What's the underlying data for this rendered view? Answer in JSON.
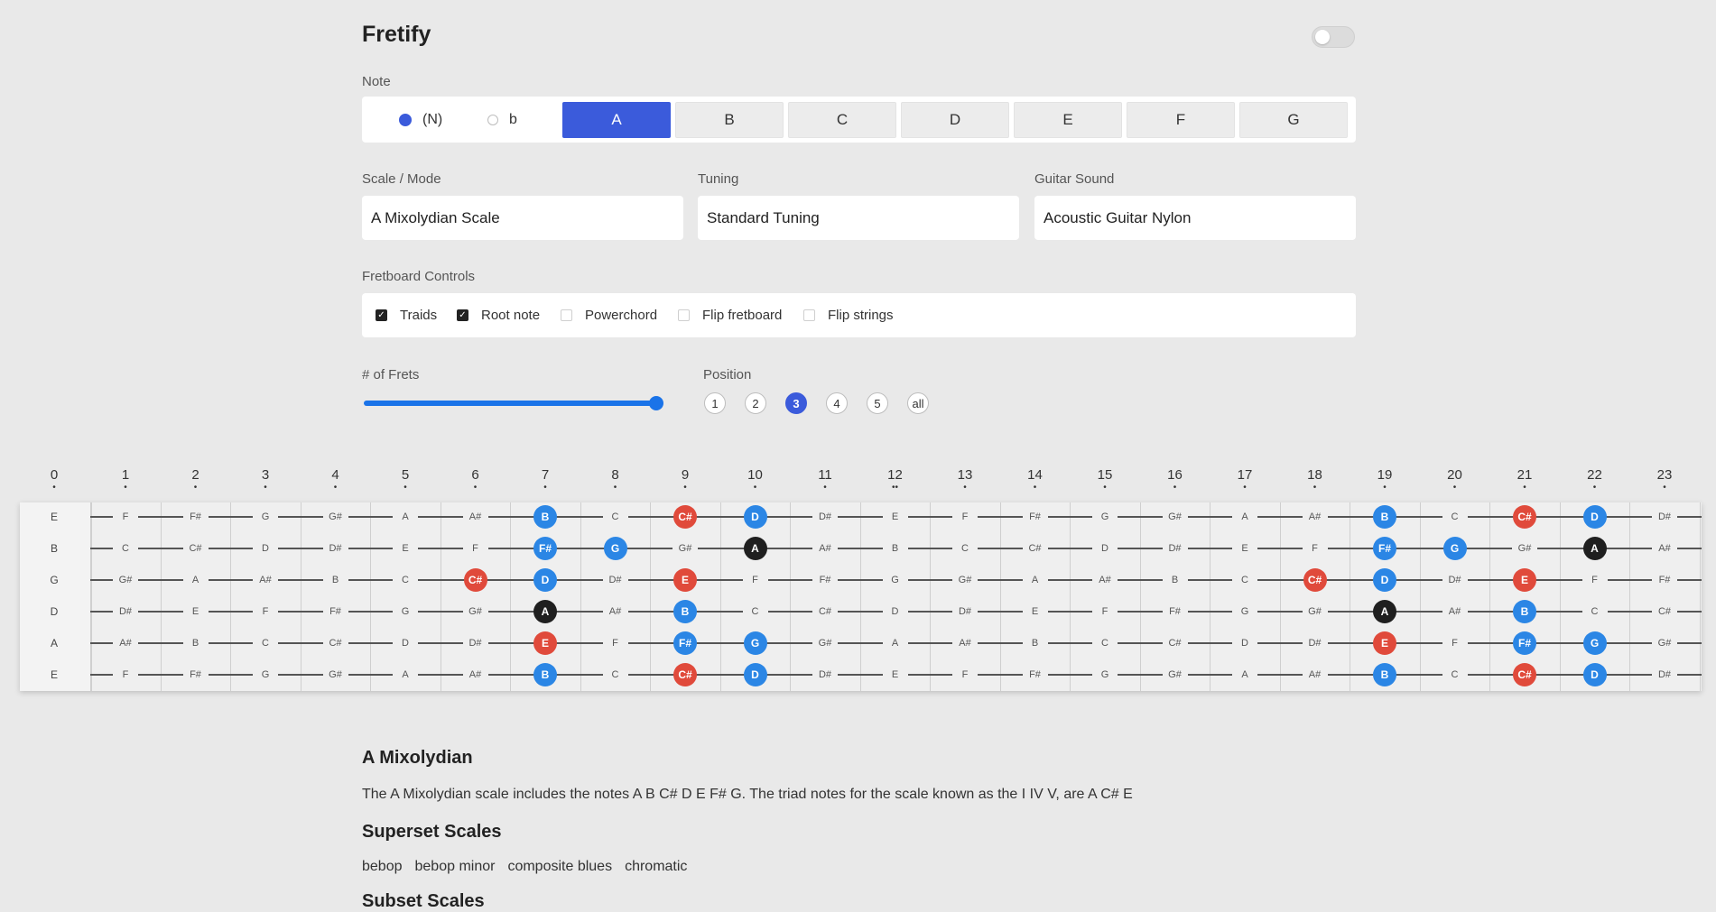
{
  "header": {
    "title": "Fretify",
    "theme_toggle_on": false
  },
  "note_selector": {
    "label": "Note",
    "accidentals": [
      {
        "label": "(N)",
        "selected": true
      },
      {
        "label": "b",
        "selected": false
      }
    ],
    "notes": [
      "A",
      "B",
      "C",
      "D",
      "E",
      "F",
      "G"
    ],
    "selected_note": "A"
  },
  "selects": {
    "scale": {
      "label": "Scale / Mode",
      "value": "A Mixolydian Scale"
    },
    "tuning": {
      "label": "Tuning",
      "value": "Standard Tuning"
    },
    "sound": {
      "label": "Guitar Sound",
      "value": "Acoustic Guitar Nylon"
    }
  },
  "fretboard_controls": {
    "label": "Fretboard Controls",
    "options": [
      {
        "label": "Traids",
        "checked": true
      },
      {
        "label": "Root note",
        "checked": true
      },
      {
        "label": "Powerchord",
        "checked": false
      },
      {
        "label": "Flip fretboard",
        "checked": false
      },
      {
        "label": "Flip strings",
        "checked": false
      }
    ]
  },
  "frets": {
    "label": "# of Frets",
    "level": 1.0
  },
  "position": {
    "label": "Position",
    "options": [
      "1",
      "2",
      "3",
      "4",
      "5",
      "all"
    ],
    "selected": "3"
  },
  "fretboard": {
    "fret_numbers": [
      "0",
      "1",
      "2",
      "3",
      "4",
      "5",
      "6",
      "7",
      "8",
      "9",
      "10",
      "11",
      "12",
      "13",
      "14",
      "15",
      "16",
      "17",
      "18",
      "19",
      "20",
      "21",
      "22",
      "23"
    ],
    "strings": [
      [
        "E",
        "F",
        "F#",
        "G",
        "G#",
        "A",
        "A#",
        "B",
        "C",
        "C#",
        "D",
        "D#",
        "E",
        "F",
        "F#",
        "G",
        "G#",
        "A",
        "A#",
        "B",
        "C",
        "C#",
        "D",
        "D#"
      ],
      [
        "B",
        "C",
        "C#",
        "D",
        "D#",
        "E",
        "F",
        "F#",
        "G",
        "G#",
        "A",
        "A#",
        "B",
        "C",
        "C#",
        "D",
        "D#",
        "E",
        "F",
        "F#",
        "G",
        "G#",
        "A",
        "A#"
      ],
      [
        "G",
        "G#",
        "A",
        "A#",
        "B",
        "C",
        "C#",
        "D",
        "D#",
        "E",
        "F",
        "F#",
        "G",
        "G#",
        "A",
        "A#",
        "B",
        "C",
        "C#",
        "D",
        "D#",
        "E",
        "F",
        "F#"
      ],
      [
        "D",
        "D#",
        "E",
        "F",
        "F#",
        "G",
        "G#",
        "A",
        "A#",
        "B",
        "C",
        "C#",
        "D",
        "D#",
        "E",
        "F",
        "F#",
        "G",
        "G#",
        "A",
        "A#",
        "B",
        "C",
        "C#"
      ],
      [
        "A",
        "A#",
        "B",
        "C",
        "C#",
        "D",
        "D#",
        "E",
        "F",
        "F#",
        "G",
        "G#",
        "A",
        "A#",
        "B",
        "C",
        "C#",
        "D",
        "D#",
        "E",
        "F",
        "F#",
        "G",
        "G#"
      ],
      [
        "E",
        "F",
        "F#",
        "G",
        "G#",
        "A",
        "A#",
        "B",
        "C",
        "C#",
        "D",
        "D#",
        "E",
        "F",
        "F#",
        "G",
        "G#",
        "A",
        "A#",
        "B",
        "C",
        "C#",
        "D",
        "D#"
      ]
    ],
    "highlights": [
      {
        "s": 0,
        "f": 7,
        "c": "blue"
      },
      {
        "s": 0,
        "f": 9,
        "c": "red"
      },
      {
        "s": 0,
        "f": 10,
        "c": "blue"
      },
      {
        "s": 0,
        "f": 19,
        "c": "blue"
      },
      {
        "s": 0,
        "f": 21,
        "c": "red"
      },
      {
        "s": 0,
        "f": 22,
        "c": "blue"
      },
      {
        "s": 1,
        "f": 7,
        "c": "blue"
      },
      {
        "s": 1,
        "f": 8,
        "c": "blue"
      },
      {
        "s": 1,
        "f": 10,
        "c": "black"
      },
      {
        "s": 1,
        "f": 19,
        "c": "blue"
      },
      {
        "s": 1,
        "f": 20,
        "c": "blue"
      },
      {
        "s": 1,
        "f": 22,
        "c": "black"
      },
      {
        "s": 2,
        "f": 6,
        "c": "red"
      },
      {
        "s": 2,
        "f": 7,
        "c": "blue"
      },
      {
        "s": 2,
        "f": 9,
        "c": "red"
      },
      {
        "s": 2,
        "f": 18,
        "c": "red"
      },
      {
        "s": 2,
        "f": 19,
        "c": "blue"
      },
      {
        "s": 2,
        "f": 21,
        "c": "red"
      },
      {
        "s": 3,
        "f": 7,
        "c": "black"
      },
      {
        "s": 3,
        "f": 9,
        "c": "blue"
      },
      {
        "s": 3,
        "f": 19,
        "c": "black"
      },
      {
        "s": 3,
        "f": 21,
        "c": "blue"
      },
      {
        "s": 4,
        "f": 7,
        "c": "red"
      },
      {
        "s": 4,
        "f": 9,
        "c": "blue"
      },
      {
        "s": 4,
        "f": 10,
        "c": "blue"
      },
      {
        "s": 4,
        "f": 19,
        "c": "red"
      },
      {
        "s": 4,
        "f": 21,
        "c": "blue"
      },
      {
        "s": 4,
        "f": 22,
        "c": "blue"
      },
      {
        "s": 5,
        "f": 7,
        "c": "blue"
      },
      {
        "s": 5,
        "f": 9,
        "c": "red"
      },
      {
        "s": 5,
        "f": 10,
        "c": "blue"
      },
      {
        "s": 5,
        "f": 19,
        "c": "blue"
      },
      {
        "s": 5,
        "f": 21,
        "c": "red"
      },
      {
        "s": 5,
        "f": 22,
        "c": "blue"
      }
    ],
    "colors": {
      "blue": "#2b86e5",
      "red": "#e04a3b",
      "black": "#1f1f1f",
      "accent": "#3b5bdb"
    }
  },
  "info": {
    "title": "A Mixolydian",
    "description": "The A Mixolydian scale includes the notes A B C# D E F# G. The triad notes for the scale known as the I IV V, are A C# E",
    "superset_title": "Superset Scales",
    "superset": [
      "bebop",
      "bebop minor",
      "composite blues",
      "chromatic"
    ],
    "subset_title": "Subset Scales"
  }
}
